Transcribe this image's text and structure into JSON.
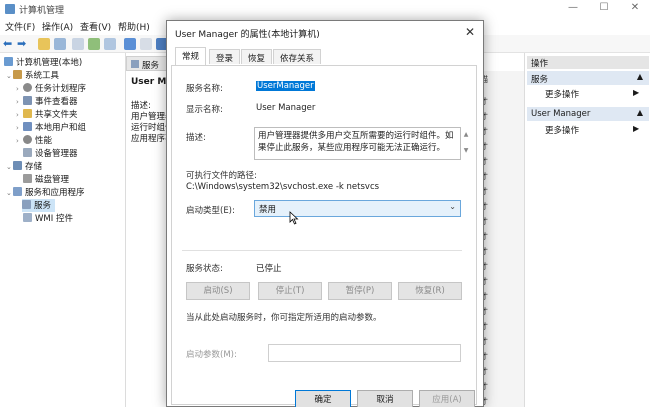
{
  "window": {
    "title": "计算机管理"
  },
  "menu": [
    "文件(F)",
    "操作(A)",
    "查看(V)",
    "帮助(H)"
  ],
  "tree": {
    "root": "计算机管理(本地)",
    "items": [
      "系统工具",
      "任务计划程序",
      "事件查看器",
      "共享文件夹",
      "本地用户和组",
      "性能",
      "设备管理器",
      "存储",
      "磁盘管理",
      "服务和应用程序",
      "服务",
      "WMI 控件"
    ]
  },
  "middle": {
    "tab_label": "服务",
    "heading": "User Manag",
    "lines": [
      "描述:",
      "用户管理器",
      "运行时组件",
      "应用程序不"
    ],
    "side_col_head": "描",
    "side_col": [
      "才",
      "才",
      "才",
      "才",
      "才",
      "才",
      "才",
      "才",
      "才",
      "才",
      "才",
      "才",
      "才",
      "才",
      "才",
      "才",
      "才",
      "才",
      "才",
      "才",
      "才"
    ]
  },
  "actions": {
    "header": "操作",
    "group1": "服务",
    "group1_item": "更多操作",
    "group2": "User Manager",
    "group2_item": "更多操作"
  },
  "dialog": {
    "title": "User Manager 的属性(本地计算机)",
    "tabs": [
      "常规",
      "登录",
      "恢复",
      "依存关系"
    ],
    "service_name_label": "服务名称:",
    "service_name": "UserManager",
    "display_name_label": "显示名称:",
    "display_name": "User Manager",
    "desc_label": "描述:",
    "desc": "用户管理器提供多用户交互所需要的运行时组件。如果停止此服务，某些应用程序可能无法正确运行。",
    "path_label": "可执行文件的路径:",
    "path": "C:\\Windows\\system32\\svchost.exe -k netsvcs",
    "startup_label": "启动类型(E):",
    "startup_value": "禁用",
    "status_label": "服务状态:",
    "status_value": "已停止",
    "buttons": [
      "启动(S)",
      "停止(T)",
      "暂停(P)",
      "恢复(R)"
    ],
    "hint": "当从此处启动服务时，你可指定所适用的启动参数。",
    "param_label": "启动参数(M):",
    "ok": "确定",
    "cancel": "取消",
    "apply": "应用(A)"
  }
}
